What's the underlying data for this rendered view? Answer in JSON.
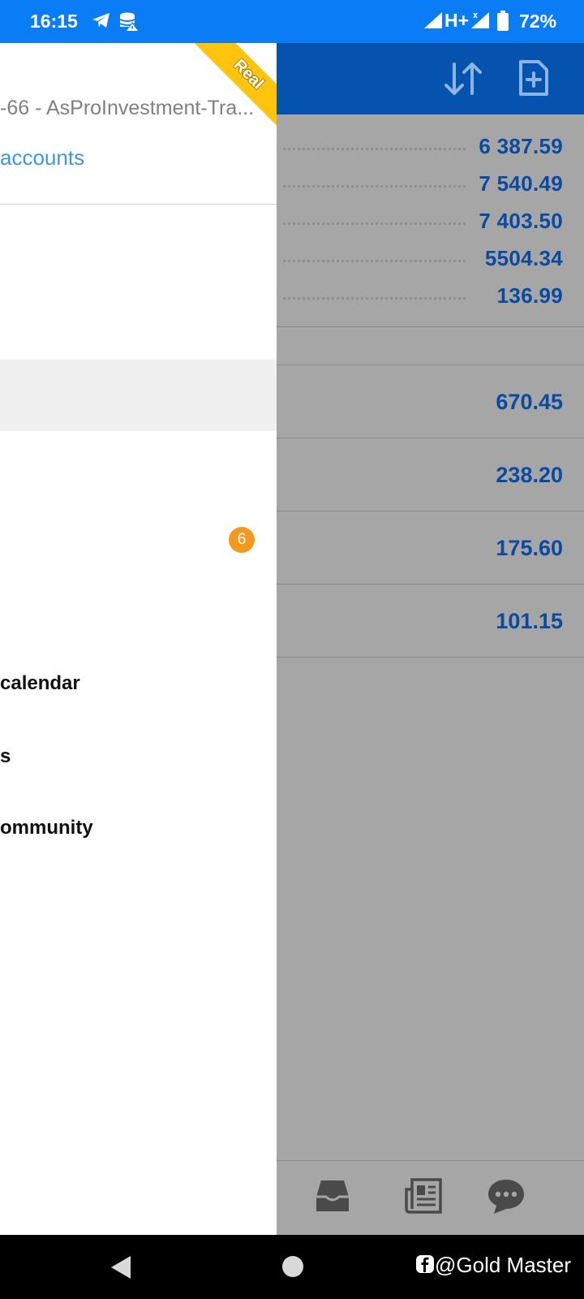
{
  "status_bar": {
    "time": "16:15",
    "network": "H+",
    "battery": "72%",
    "icons": [
      "telegram-icon",
      "database-warning-icon",
      "signal-icon",
      "battery-icon"
    ]
  },
  "drawer": {
    "account_line": "-66 - AsProInvestment-Tra...",
    "accounts_link": "accounts",
    "ribbon": "Real",
    "badge_count": "6",
    "menu": {
      "calendar": "calendar",
      "s": "s",
      "community": "ommunity"
    }
  },
  "background": {
    "values": [
      "6 387.59",
      "7 540.49",
      "7 403.50",
      "5504.34",
      "136.99"
    ],
    "list_values": [
      "670.45",
      "238.20",
      "175.60",
      "101.15"
    ],
    "header_icons": [
      "sort-icon",
      "add-document-icon"
    ],
    "bottom_icons": [
      "inbox-icon",
      "news-icon",
      "chat-icon"
    ]
  },
  "nav_bar": {
    "watermark": "@Gold Master"
  },
  "colors": {
    "status_bar": "#0a7cf6",
    "header": "#0553ac",
    "value_text": "#0a4aa0",
    "link": "#3c96e0",
    "ribbon": "#ffc40d",
    "badge": "#f39a1e"
  }
}
